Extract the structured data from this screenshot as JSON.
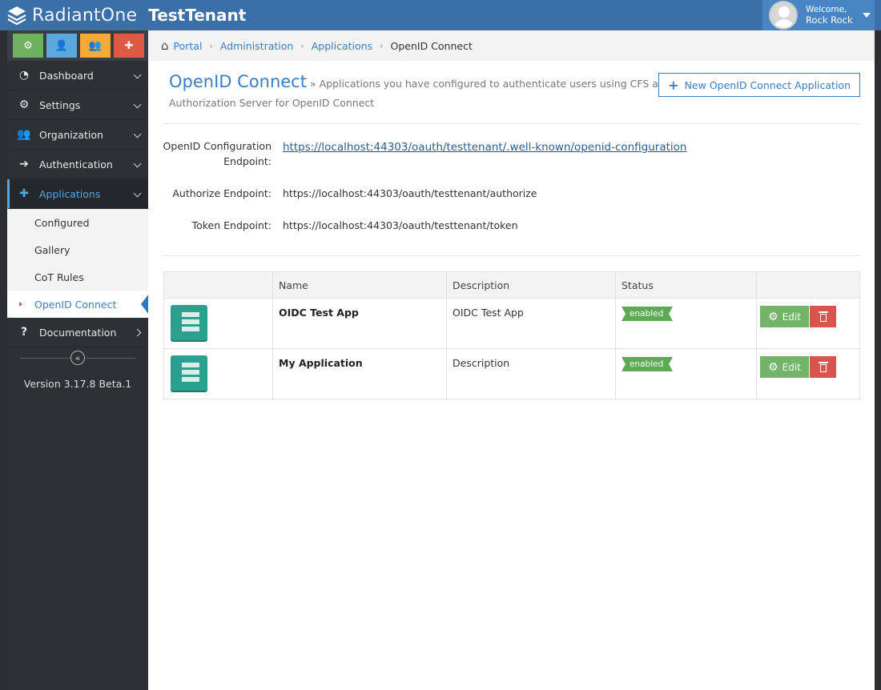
{
  "header": {
    "brand": "RadiantOne",
    "tenant": "TestTenant",
    "welcome": "Welcome,",
    "username": "Rock Rock"
  },
  "sidebar": {
    "quick_buttons": [
      {
        "icon": "gears-icon",
        "color": "#70b061"
      },
      {
        "icon": "user-icon",
        "color": "#5aa8dc"
      },
      {
        "icon": "users-icon",
        "color": "#f7a936"
      },
      {
        "icon": "puzzle-icon",
        "color": "#de5a45"
      }
    ],
    "items": [
      {
        "label": "Dashboard",
        "icon": "dashboard-icon"
      },
      {
        "label": "Settings",
        "icon": "settings-icon"
      },
      {
        "label": "Organization",
        "icon": "organization-icon"
      },
      {
        "label": "Authentication",
        "icon": "sign-in-icon"
      },
      {
        "label": "Applications",
        "icon": "puzzle-icon"
      },
      {
        "label": "Documentation",
        "icon": "question-icon"
      }
    ],
    "sub_items": [
      "Configured",
      "Gallery",
      "CoT Rules",
      "OpenID Connect"
    ],
    "collapse_glyph": "«",
    "version": "Version 3.17.8 Beta.1"
  },
  "breadcrumb": {
    "items": [
      "Portal",
      "Administration",
      "Applications"
    ],
    "current": "OpenID Connect"
  },
  "page": {
    "title": "OpenID Connect",
    "subtitle": "» Applications you have configured to authenticate users using CFS as an Authorization Server for OpenID Connect",
    "new_button": "New OpenID Connect Application"
  },
  "endpoints": {
    "config_label": "OpenID Configuration Endpoint:",
    "config_value": "https://localhost:44303/oauth/testtenant/.well-known/openid-configuration",
    "authorize_label": "Authorize Endpoint:",
    "authorize_value": "https://localhost:44303/oauth/testtenant/authorize",
    "token_label": "Token Endpoint:",
    "token_value": "https://localhost:44303/oauth/testtenant/token"
  },
  "table": {
    "headers": [
      "",
      "Name",
      "Description",
      "Status",
      ""
    ],
    "rows": [
      {
        "name": "OIDC Test App",
        "description": "OIDC Test App",
        "status": "enabled",
        "edit": "Edit"
      },
      {
        "name": "My Application",
        "description": "Description",
        "status": "enabled",
        "edit": "Edit"
      }
    ]
  },
  "colors": {
    "header_bg": "#3a6fa8",
    "accent": "#3a7ec2",
    "status_enabled": "#5eaa54",
    "edit_green": "#74b46a",
    "delete_red": "#d9534f"
  }
}
